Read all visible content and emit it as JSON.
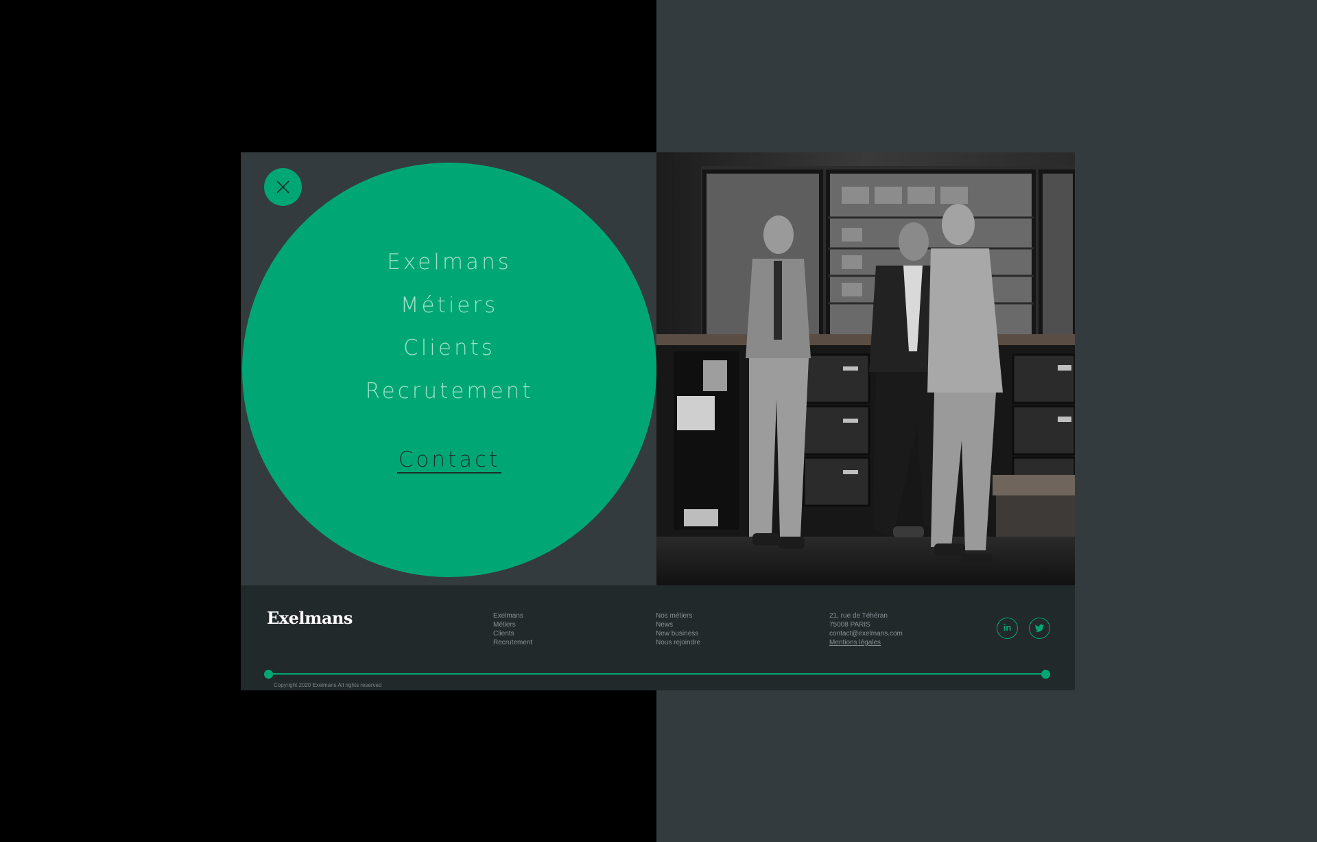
{
  "menu": {
    "close_label": "",
    "items": [
      "Exelmans",
      "Métiers",
      "Clients",
      "Recrutement"
    ],
    "contact": "Contact"
  },
  "footer": {
    "logo": "Exelmans",
    "col1": [
      "Exelmans",
      "Métiers",
      "Clients",
      "Recrutement"
    ],
    "col2": [
      "Nos métiers",
      "News",
      "New business",
      "Nous rejoindre"
    ],
    "address": {
      "line1": "21, rue de Téhéran",
      "line2": "75008 PARIS",
      "email": "contact@exelmans.com",
      "legal": "Mentions légales"
    },
    "social": [
      "in",
      "twitter-bird"
    ],
    "copyright": "Copyright 2020 Exelmans All rights reserved"
  },
  "colors": {
    "accent": "#00a775",
    "panel": "#343b3e",
    "footer": "#22292b"
  }
}
